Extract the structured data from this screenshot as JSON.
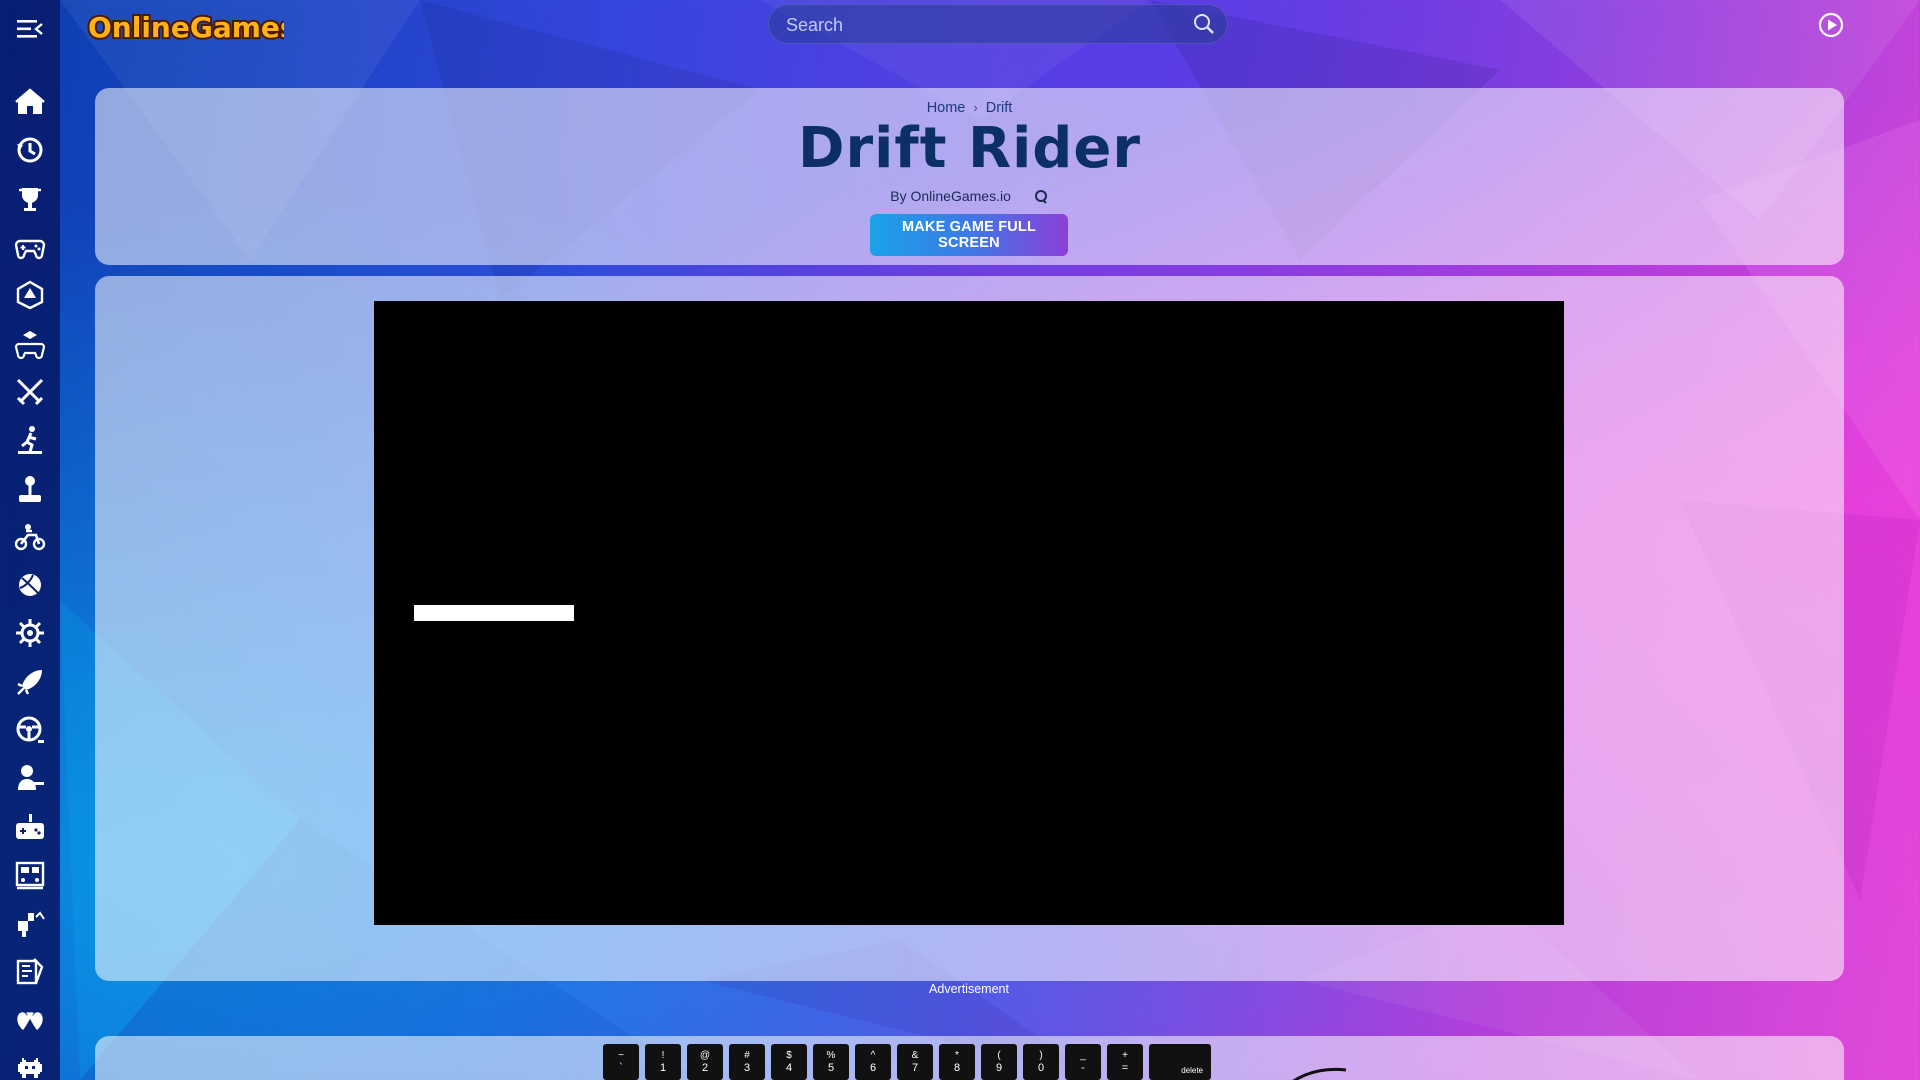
{
  "header": {
    "logo_text": "OnlineGames.io",
    "search_placeholder": "Search"
  },
  "sidebar": {
    "items": [
      {
        "icon": "home-icon"
      },
      {
        "icon": "history-icon"
      },
      {
        "icon": "trophy-icon"
      },
      {
        "icon": "gamepad-icon"
      },
      {
        "icon": "dice-icon"
      },
      {
        "icon": "controller-cube-icon"
      },
      {
        "icon": "crossed-swords-icon"
      },
      {
        "icon": "runner-icon"
      },
      {
        "icon": "joystick-icon"
      },
      {
        "icon": "motorbike-icon"
      },
      {
        "icon": "ball-icon"
      },
      {
        "icon": "gear-icon"
      },
      {
        "icon": "rocket-icon"
      },
      {
        "icon": "steering-wheel-icon"
      },
      {
        "icon": "shooter-icon"
      },
      {
        "icon": "robot-controller-icon"
      },
      {
        "icon": "train-icon"
      },
      {
        "icon": "building-blocks-icon"
      },
      {
        "icon": "puzzle-icon"
      },
      {
        "icon": "hearts-icon"
      },
      {
        "icon": "space-invader-icon"
      }
    ]
  },
  "breadcrumb": {
    "home": "Home",
    "separator": "›",
    "category": "Drift"
  },
  "game": {
    "title": "Drift Rider",
    "byline": "By OnlineGames.io",
    "fullscreen_label": "MAKE GAME FULL SCREEN"
  },
  "ad_label": "Advertisement",
  "keyboard": {
    "keys": [
      {
        "top": "~",
        "bottom": "`"
      },
      {
        "top": "!",
        "bottom": "1"
      },
      {
        "top": "@",
        "bottom": "2"
      },
      {
        "top": "#",
        "bottom": "3"
      },
      {
        "top": "$",
        "bottom": "4"
      },
      {
        "top": "%",
        "bottom": "5"
      },
      {
        "top": "^",
        "bottom": "6"
      },
      {
        "top": "&",
        "bottom": "7"
      },
      {
        "top": "*",
        "bottom": "8"
      },
      {
        "top": "(",
        "bottom": "9"
      },
      {
        "top": ")",
        "bottom": "0"
      },
      {
        "top": "_",
        "bottom": "-"
      },
      {
        "top": "+",
        "bottom": "="
      }
    ],
    "delete_label": "delete"
  },
  "colors": {
    "sidebar_bg": "#081c6e",
    "title": "#0c2f66",
    "button_gradient_start": "#1aa3e8",
    "button_gradient_end": "#8c3fd8",
    "game_bg": "#000000"
  }
}
